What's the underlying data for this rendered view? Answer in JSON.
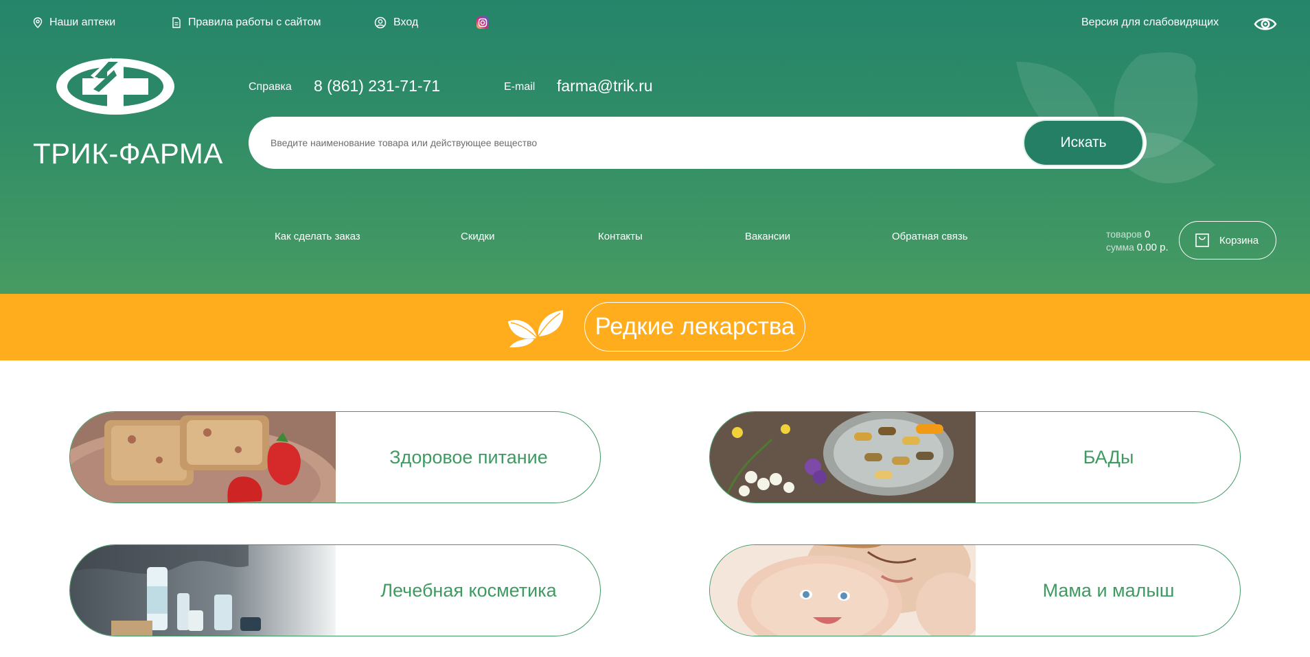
{
  "topbar": {
    "pharmacies": "Наши аптеки",
    "rules": "Правила работы с сайтом",
    "login": "Вход",
    "vision": "Версия для слабовидящих",
    "instagram_icon": "instagram-icon"
  },
  "brand": {
    "name": "ТРИК-ФАРМА"
  },
  "contacts": {
    "phone_label": "Справка",
    "phone": "8 (861) 231-71-71",
    "email_label": "E-mail",
    "email": "farma@trik.ru"
  },
  "search": {
    "placeholder": "Введите наименование товара или действующее вещество",
    "button": "Искать"
  },
  "nav": {
    "items": [
      {
        "label": "Как сделать заказ"
      },
      {
        "label": "Скидки"
      },
      {
        "label": "Контакты"
      },
      {
        "label": "Вакансии"
      },
      {
        "label": "Обратная связь"
      }
    ]
  },
  "cart": {
    "items_label": "товаров",
    "items_count": "0",
    "sum_label": "сумма",
    "sum_value": "0.00 р.",
    "button": "Корзина"
  },
  "banner": {
    "label": "Редкие лекарства"
  },
  "categories": [
    {
      "label": "Здоровое питание"
    },
    {
      "label": "БАДы"
    },
    {
      "label": "Лечебная косметика"
    },
    {
      "label": "Мама и малыш"
    }
  ],
  "colors": {
    "header_top": "#25856a",
    "header_bottom": "#479b62",
    "button_green": "#247f64",
    "band_orange": "#ffad1d",
    "card_text": "#3f9a62"
  }
}
